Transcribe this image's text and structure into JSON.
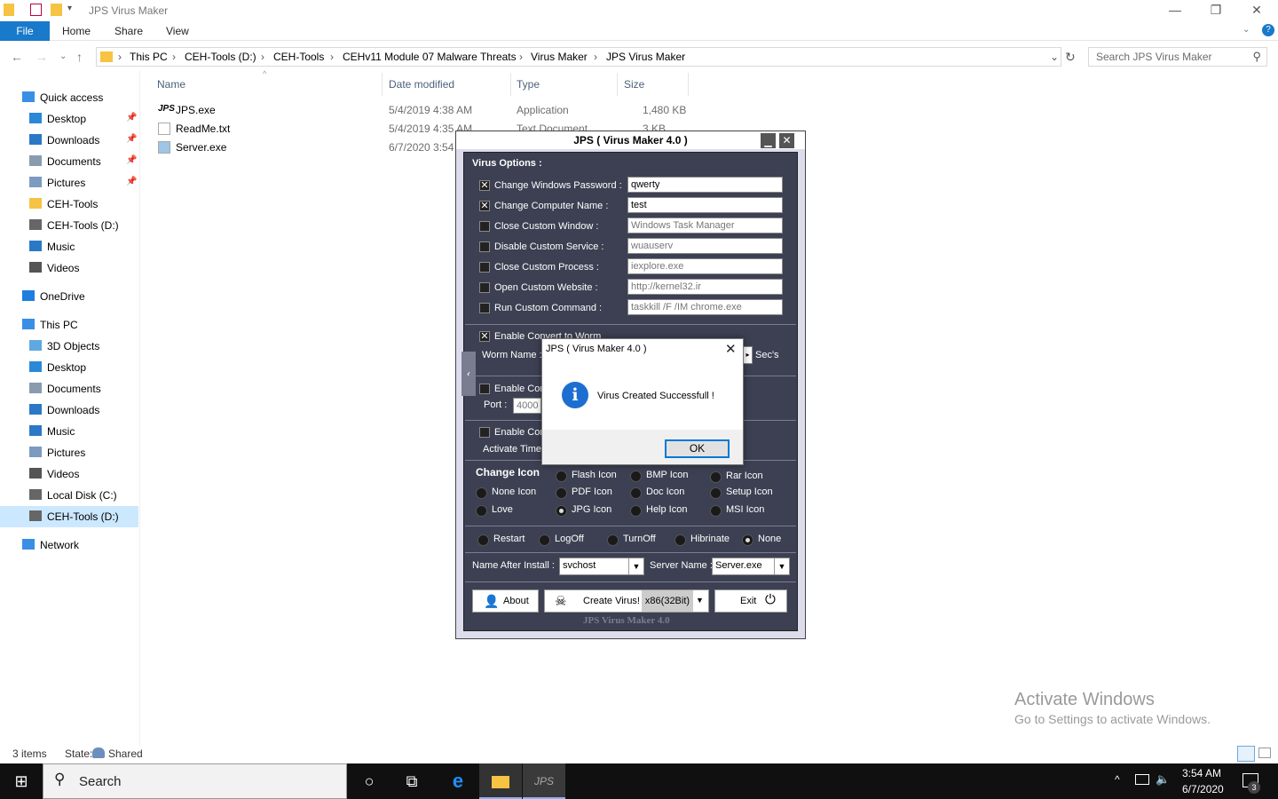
{
  "window": {
    "title": "JPS Virus Maker",
    "controls": {
      "minimize": "—",
      "maximize": "❐",
      "close": "✕"
    }
  },
  "ribbon": {
    "file": "File",
    "tabs": [
      "Home",
      "Share",
      "View"
    ]
  },
  "address": {
    "crumbs": [
      "This PC",
      "CEH-Tools (D:)",
      "CEH-Tools",
      "CEHv11 Module 07 Malware Threats",
      "Virus Maker",
      "JPS Virus Maker"
    ],
    "search_placeholder": "Search JPS Virus Maker"
  },
  "nav": {
    "items": [
      {
        "label": "Quick access",
        "icon": "star-icon",
        "pinned": false
      },
      {
        "label": "Desktop",
        "icon": "desktop-icon",
        "pinned": true
      },
      {
        "label": "Downloads",
        "icon": "download-icon",
        "pinned": true
      },
      {
        "label": "Documents",
        "icon": "document-icon",
        "pinned": true
      },
      {
        "label": "Pictures",
        "icon": "pictures-icon",
        "pinned": true
      },
      {
        "label": "CEH-Tools",
        "icon": "folder-icon",
        "pinned": false
      },
      {
        "label": "CEH-Tools (D:)",
        "icon": "drive-icon",
        "pinned": false
      },
      {
        "label": "Music",
        "icon": "music-icon",
        "pinned": false
      },
      {
        "label": "Videos",
        "icon": "video-icon",
        "pinned": false
      },
      {
        "label": "OneDrive",
        "icon": "cloud-icon",
        "pinned": false
      },
      {
        "label": "This PC",
        "icon": "computer-icon",
        "pinned": false
      },
      {
        "label": "3D Objects",
        "icon": "cube-icon",
        "pinned": false
      },
      {
        "label": "Desktop",
        "icon": "desktop-icon",
        "pinned": false
      },
      {
        "label": "Documents",
        "icon": "document-icon",
        "pinned": false
      },
      {
        "label": "Downloads",
        "icon": "download-icon",
        "pinned": false
      },
      {
        "label": "Music",
        "icon": "music-icon",
        "pinned": false
      },
      {
        "label": "Pictures",
        "icon": "pictures-icon",
        "pinned": false
      },
      {
        "label": "Videos",
        "icon": "video-icon",
        "pinned": false
      },
      {
        "label": "Local Disk (C:)",
        "icon": "drive-icon",
        "pinned": false
      },
      {
        "label": "CEH-Tools (D:)",
        "icon": "drive-icon",
        "pinned": false
      },
      {
        "label": "Network",
        "icon": "network-icon",
        "pinned": false
      }
    ]
  },
  "columns": {
    "name": "Name",
    "date": "Date modified",
    "type": "Type",
    "size": "Size"
  },
  "files": [
    {
      "name": "JPS.exe",
      "date": "5/4/2019 4:38 AM",
      "type": "Application",
      "size": "1,480 KB"
    },
    {
      "name": "ReadMe.txt",
      "date": "5/4/2019 4:35 AM",
      "type": "Text Document",
      "size": "3 KB"
    },
    {
      "name": "Server.exe",
      "date": "6/7/2020 3:54",
      "type": "",
      "size": ""
    }
  ],
  "status": {
    "count": "3 items",
    "state_label": "State:",
    "state_value": "Shared"
  },
  "watermark": {
    "line1": "Activate Windows",
    "line2": "Go to Settings to activate Windows."
  },
  "jps": {
    "title": "JPS ( Virus Maker 4.0 )",
    "virus_options": "Virus Options :",
    "options": [
      {
        "label": "Change Windows Password :",
        "checked": true,
        "value": "qwerty"
      },
      {
        "label": "Change Computer Name :",
        "checked": true,
        "value": "test"
      },
      {
        "label": "Close Custom Window :",
        "checked": false,
        "value": "Windows Task Manager"
      },
      {
        "label": "Disable Custom Service :",
        "checked": false,
        "value": "wuauserv"
      },
      {
        "label": "Close Custom Process :",
        "checked": false,
        "value": "iexplore.exe"
      },
      {
        "label": "Open Custom Website :",
        "checked": false,
        "value": "http://kernel32.ir"
      },
      {
        "label": "Run Custom Command :",
        "checked": false,
        "value": "taskkill /F /IM chrome.exe"
      }
    ],
    "worm_enable": "Enable Convert to Worm",
    "worm_name": "Worm Name :",
    "secs": "Sec's",
    "enable_con": "Enable Con",
    "port_label": "Port :",
    "port_value": "4000",
    "enable_con2": "Enable Con",
    "activate_time": "Activate Time",
    "change_icon": "Change Icon",
    "icons": [
      {
        "label": "Flash Icon",
        "on": false
      },
      {
        "label": "BMP Icon",
        "on": false
      },
      {
        "label": "Rar Icon",
        "on": false
      },
      {
        "label": "None Icon",
        "on": false
      },
      {
        "label": "PDF Icon",
        "on": false
      },
      {
        "label": "Doc Icon",
        "on": false
      },
      {
        "label": "Setup Icon",
        "on": false
      },
      {
        "label": "Love",
        "on": false
      },
      {
        "label": "JPG Icon",
        "on": true
      },
      {
        "label": "Help Icon",
        "on": false
      },
      {
        "label": "MSI Icon",
        "on": false
      }
    ],
    "power": [
      {
        "label": "Restart",
        "on": false
      },
      {
        "label": "LogOff",
        "on": false
      },
      {
        "label": "TurnOff",
        "on": false
      },
      {
        "label": "Hibrinate",
        "on": false
      },
      {
        "label": "None",
        "on": true
      }
    ],
    "name_after_install_label": "Name After Install :",
    "name_after_install": "svchost",
    "server_name_label": "Server Name :",
    "server_name": "Server.exe",
    "about": "About",
    "create": "Create Virus!",
    "arch": "x86(32Bit)",
    "exit": "Exit",
    "footer": "JPS Virus Maker 4.0"
  },
  "dialog": {
    "title": "JPS ( Virus Maker 4.0 )",
    "message": "Virus Created Successfull !",
    "ok": "OK"
  },
  "taskbar": {
    "search": "Search",
    "time": "3:54 AM",
    "date": "6/7/2020",
    "notifications": "3"
  }
}
